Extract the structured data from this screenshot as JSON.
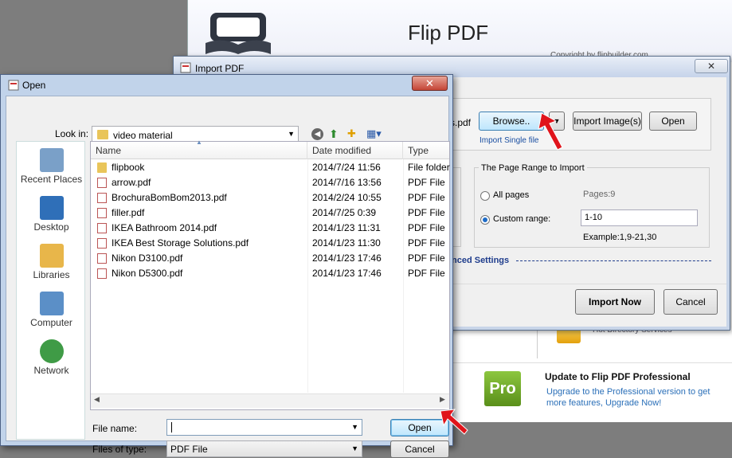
{
  "flip_window": {
    "title": "Flip PDF",
    "copyright": "Copyright by flipbuilder.com",
    "hot_directory": "Hot Directory Services",
    "pro_badge": "Pro",
    "pro_title": "Update to Flip PDF Professional",
    "pro_text": "Upgrade to the Professional version to get more features, Upgrade Now!"
  },
  "import_dialog": {
    "title": "Import PDF",
    "close": "✕",
    "file_fragment": "s.pdf",
    "browse": "Browse..",
    "dropdown": "▼",
    "import_images": "Import Image(s)",
    "open": "Open",
    "single_file": "Import Single file",
    "range_title": "The Page Range to Import",
    "all_pages": "All pages",
    "pages_count": "Pages:9",
    "custom_range": "Custom range:",
    "range_value": "1-10",
    "range_example": "Example:1,9-21,30",
    "advanced": "nced Settings",
    "import_now": "Import Now",
    "cancel": "Cancel"
  },
  "open_dialog": {
    "title": "Open",
    "close": "✕",
    "look_in_label": "Look in:",
    "look_in_value": "video material",
    "places": [
      {
        "label": "Recent Places",
        "color": "#7aa0c8"
      },
      {
        "label": "Desktop",
        "color": "#2f6fb8"
      },
      {
        "label": "Libraries",
        "color": "#e8b64a"
      },
      {
        "label": "Computer",
        "color": "#5b8fc7"
      },
      {
        "label": "Network",
        "color": "#3f9b46"
      }
    ],
    "columns": {
      "name": "Name",
      "date": "Date modified",
      "type": "Type"
    },
    "files": [
      {
        "name": "flipbook",
        "date": "2014/7/24 11:56",
        "type": "File folder",
        "kind": "folder"
      },
      {
        "name": "arrow.pdf",
        "date": "2014/7/16 13:56",
        "type": "PDF File",
        "kind": "pdf"
      },
      {
        "name": "BrochuraBomBom2013.pdf",
        "date": "2014/2/24 10:55",
        "type": "PDF File",
        "kind": "pdf"
      },
      {
        "name": "filler.pdf",
        "date": "2014/7/25 0:39",
        "type": "PDF File",
        "kind": "pdf"
      },
      {
        "name": "IKEA Bathroom 2014.pdf",
        "date": "2014/1/23 11:31",
        "type": "PDF File",
        "kind": "pdf"
      },
      {
        "name": "IKEA Best Storage Solutions.pdf",
        "date": "2014/1/23 11:30",
        "type": "PDF File",
        "kind": "pdf"
      },
      {
        "name": "Nikon D3100.pdf",
        "date": "2014/1/23 17:46",
        "type": "PDF File",
        "kind": "pdf"
      },
      {
        "name": "Nikon D5300.pdf",
        "date": "2014/1/23 17:46",
        "type": "PDF File",
        "kind": "pdf"
      }
    ],
    "file_name_label": "File name:",
    "file_name_value": "",
    "files_of_type_label": "Files of type:",
    "files_of_type_value": "PDF File",
    "open_button": "Open",
    "cancel_button": "Cancel"
  },
  "colors": {
    "accent_arrow": "#e0141b",
    "link_blue": "#1a4ea1"
  }
}
